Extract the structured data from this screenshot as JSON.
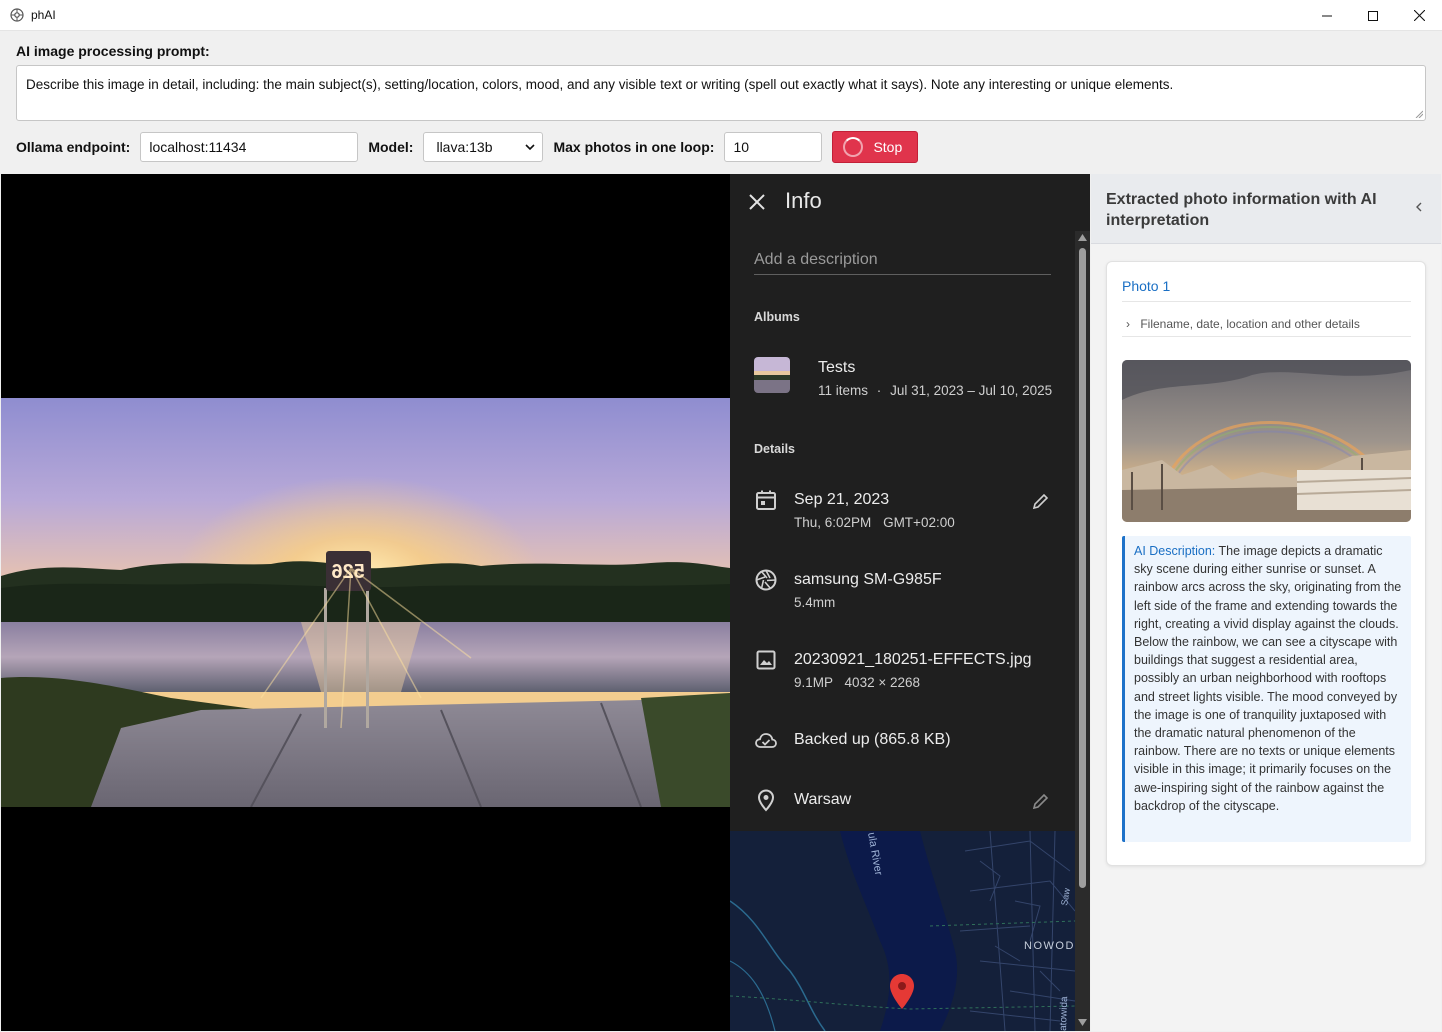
{
  "window": {
    "title": "phAI"
  },
  "toolbar": {
    "prompt_label": "AI image processing prompt:",
    "prompt_text": "Describe this image in detail, including: the main subject(s), setting/location, colors, mood, and any visible text or writing (spell out exactly what it says). Note any interesting or unique elements.",
    "endpoint_label": "Ollama endpoint:",
    "endpoint_value": "localhost:11434",
    "model_label": "Model:",
    "model_value": "llava:13b",
    "max_label": "Max photos in one loop:",
    "max_value": "10",
    "stop_label": "Stop"
  },
  "info_panel": {
    "title": "Info",
    "description_placeholder": "Add a description",
    "albums_heading": "Albums",
    "album": {
      "name": "Tests",
      "items": "11 items",
      "dates": "Jul 31, 2023 – Jul 10, 2025"
    },
    "details_heading": "Details",
    "date": "Sep 21, 2023",
    "time": "Thu, 6:02PM",
    "timezone": "GMT+02:00",
    "camera": "samsung SM-G985F",
    "focal": "5.4mm",
    "filename": "20230921_180251-EFFECTS.jpg",
    "megapixels": "9.1MP",
    "resolution": "4032 × 2268",
    "backup": "Backed up (865.8 KB)",
    "location": "Warsaw",
    "map_labels": {
      "river": "ula River",
      "district": "NOWOD",
      "street": "atowida",
      "street2": "Saw"
    }
  },
  "right_panel": {
    "title": "Extracted photo information with AI interpretation",
    "photo_title": "Photo 1",
    "details_toggle": "Filename, date, location and other details",
    "ai_label": "AI Description:",
    "ai_text": "The image depicts a dramatic sky scene during either sunrise or sunset. A rainbow arcs across the sky, originating from the left side of the frame and extending towards the right, creating a vivid display against the clouds. Below the rainbow, we can see a cityscape with buildings that suggest a residential area, possibly an urban neighborhood with rooftops and street lights visible. The mood conveyed by the image is one of tranquility juxtaposed with the dramatic natural phenomenon of the rainbow. There are no texts or unique elements visible in this image; it primarily focuses on the awe-inspiring sight of the rainbow against the backdrop of the cityscape."
  },
  "photo": {
    "sign_text": "526"
  },
  "colors": {
    "accent": "#1a6fc4",
    "stop": "#e0344c",
    "panel_dark": "#1f1f1f",
    "map_pin": "#e53935"
  }
}
